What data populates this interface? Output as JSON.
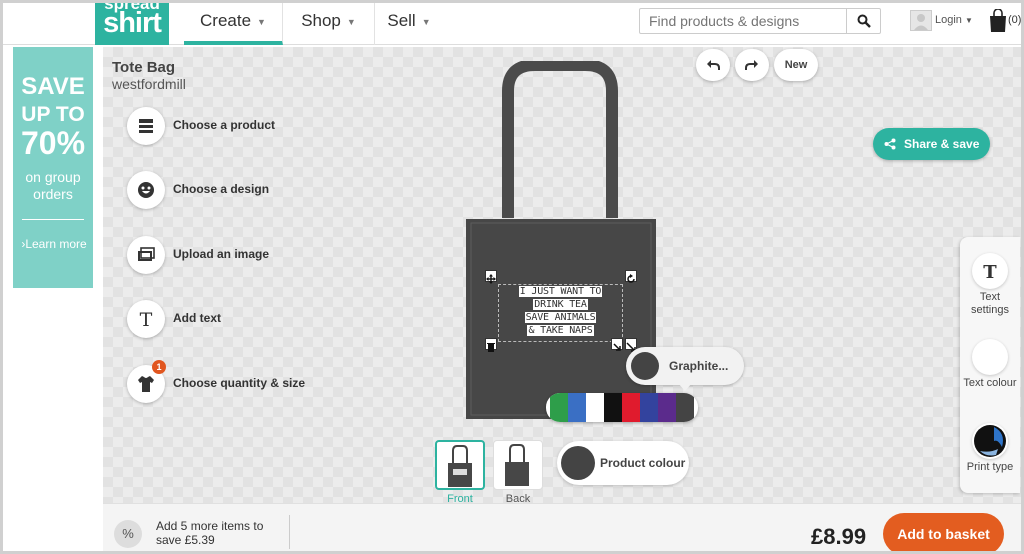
{
  "brand": {
    "logo_line1": "spread",
    "logo_line2": "shirt",
    "accent": "#2db3a0"
  },
  "nav": {
    "items": [
      {
        "label": "Create"
      },
      {
        "label": "Shop"
      },
      {
        "label": "Sell"
      }
    ]
  },
  "search": {
    "placeholder": "Find products & designs",
    "icon": "search-icon"
  },
  "account": {
    "login_label": "Login",
    "basket_count": "(0)"
  },
  "promo": {
    "line1": "SAVE",
    "line2": "UP TO",
    "line3": "70%",
    "line4": "on group",
    "line5": "orders",
    "link": "Learn more"
  },
  "product": {
    "title": "Tote Bag",
    "subtitle": "westfordmill"
  },
  "steps": [
    {
      "label": "Choose a product",
      "icon": "product-icon"
    },
    {
      "label": "Choose a design",
      "icon": "smiley-icon"
    },
    {
      "label": "Upload an image",
      "icon": "upload-icon"
    },
    {
      "label": "Add text",
      "icon": "text-icon"
    },
    {
      "label": "Choose quantity & size",
      "icon": "tshirt-icon",
      "badge": "1"
    }
  ],
  "canvas_controls": {
    "undo_icon": "undo-icon",
    "redo_icon": "redo-icon",
    "new_label": "New"
  },
  "share": {
    "label": "Share & save"
  },
  "design_text": {
    "lines": [
      "I JUST WANT TO",
      "DRINK TEA",
      "SAVE ANIMALS",
      "& TAKE NAPS"
    ]
  },
  "right_tools": [
    {
      "label": "Text settings"
    },
    {
      "label": "Text colour"
    },
    {
      "label": "Print type"
    }
  ],
  "colour_picker": {
    "tooltip": "Graphite...",
    "selected": "#444444",
    "swatches": [
      "#2e9e4a",
      "#3a6fc4",
      "#ffffff",
      "#111111",
      "#e01b2d",
      "#33439e",
      "#5b2b8c",
      "#444444"
    ]
  },
  "views": {
    "front": "Front",
    "back": "Back"
  },
  "product_colour": {
    "label": "Product colour",
    "color": "#444444"
  },
  "footer": {
    "save_icon": "%",
    "save_line1": "Add 5 more items to",
    "save_line2": "save £5.39",
    "price": "£8.99",
    "add_label": "Add to basket"
  }
}
